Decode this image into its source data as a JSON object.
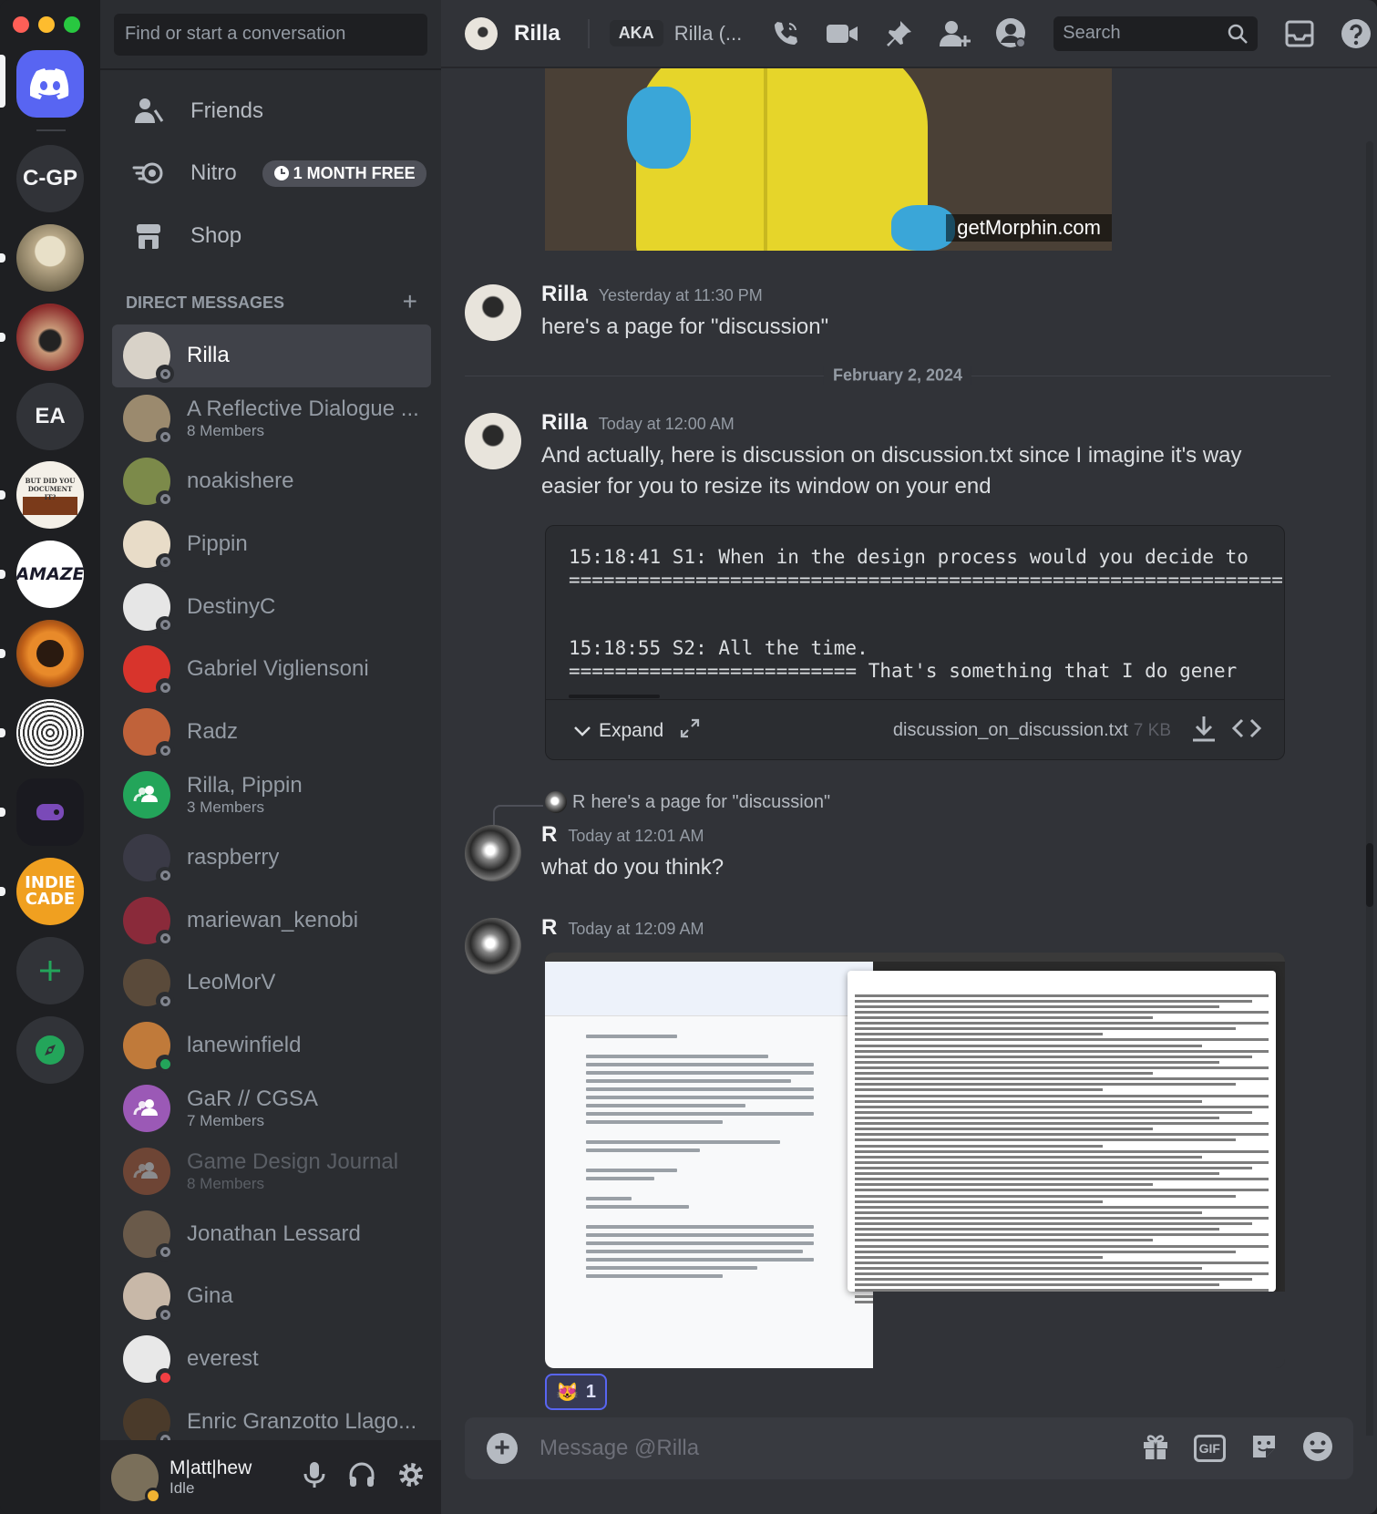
{
  "window": {
    "title": "Discord"
  },
  "servers": [
    {
      "label": "C-GP"
    },
    {
      "label": "EA"
    },
    {
      "label": "BUT DID YOU DOCUMENT IT?"
    },
    {
      "label": "AMAZE"
    },
    {
      "label": "INDIE CADE"
    }
  ],
  "sidebar": {
    "search_placeholder": "Find or start a conversation",
    "nav": {
      "friends": "Friends",
      "nitro": "Nitro",
      "nitro_badge": "1 MONTH FREE",
      "shop": "Shop"
    },
    "dm_header": "DIRECT MESSAGES",
    "dm_add": "+",
    "dms": [
      {
        "name": "Rilla",
        "sub": "",
        "color": "#d8d2c8"
      },
      {
        "name": "A Reflective Dialogue ...",
        "sub": "8 Members",
        "color": "#9b8a6e"
      },
      {
        "name": "noakishere",
        "sub": "",
        "color": "#7c8a4a"
      },
      {
        "name": "Pippin",
        "sub": "",
        "color": "#e8dcc8"
      },
      {
        "name": "DestinyC",
        "sub": "",
        "color": "#e6e6e6"
      },
      {
        "name": "Gabriel Vigliensoni",
        "sub": "",
        "color": "#d8342c"
      },
      {
        "name": "Radz",
        "sub": "",
        "color": "#c0623a"
      },
      {
        "name": "Rilla, Pippin",
        "sub": "3 Members",
        "color": "#23a55a"
      },
      {
        "name": "raspberry",
        "sub": "",
        "color": "#3a3a46"
      },
      {
        "name": "mariewan_kenobi",
        "sub": "",
        "color": "#8a2a3a"
      },
      {
        "name": "LeoMorV",
        "sub": "",
        "color": "#5a4a3a"
      },
      {
        "name": "lanewinfield",
        "sub": "",
        "color": "#c07a3a"
      },
      {
        "name": "GaR // CGSA",
        "sub": "7 Members",
        "color": "#9b59b6"
      },
      {
        "name": "Game Design Journal",
        "sub": "8 Members",
        "color": "#c0623a"
      },
      {
        "name": "Jonathan Lessard",
        "sub": "",
        "color": "#6a5a4a"
      },
      {
        "name": "Gina",
        "sub": "",
        "color": "#c8b8a8"
      },
      {
        "name": "everest",
        "sub": "",
        "color": "#e8e8e8"
      },
      {
        "name": "Enric Granzotto Llago...",
        "sub": "",
        "color": "#4a3a2a"
      }
    ]
  },
  "user": {
    "name": "M|att|hew",
    "status": "Idle"
  },
  "header": {
    "name": "Rilla",
    "aka_badge": "AKA",
    "aka_name": "Rilla (...",
    "search_placeholder": "Search"
  },
  "chat": {
    "gif_watermark": "getMorphin.com",
    "date_separator": "February 2, 2024",
    "messages": [
      {
        "author": "Rilla",
        "timestamp": "Yesterday at 11:30 PM",
        "text": "here's a page for \"discussion\""
      },
      {
        "author": "Rilla",
        "timestamp": "Today at 12:00 AM",
        "text_line1": "And actually, here is discussion on discussion.txt since I imagine it's way",
        "text_line2": "easier for you to resize its window on your end"
      },
      {
        "author": "R",
        "timestamp": "Today at 12:01 AM",
        "text": "what do you think?",
        "reply_author": "R",
        "reply_text": "here's a page for \"discussion\""
      },
      {
        "author": "R",
        "timestamp": "Today at 12:09 AM"
      }
    ],
    "attachment": {
      "line1": "15:18:41 S1: When in the design process would you decide to",
      "line2": "==============================================================",
      "line3": "15:18:55 S2: All the time.",
      "line4": "========================= That's something that I do gener",
      "expand_label": "Expand",
      "filename": "discussion_on_discussion.txt",
      "filesize": "7 KB"
    },
    "reaction": {
      "emoji": "😻",
      "count": "1"
    }
  },
  "composer": {
    "placeholder": "Message @Rilla",
    "gif_label": "GIF"
  },
  "colors": {
    "blurple": "#5865f2",
    "green": "#23a55a",
    "idle": "#f0b232"
  }
}
